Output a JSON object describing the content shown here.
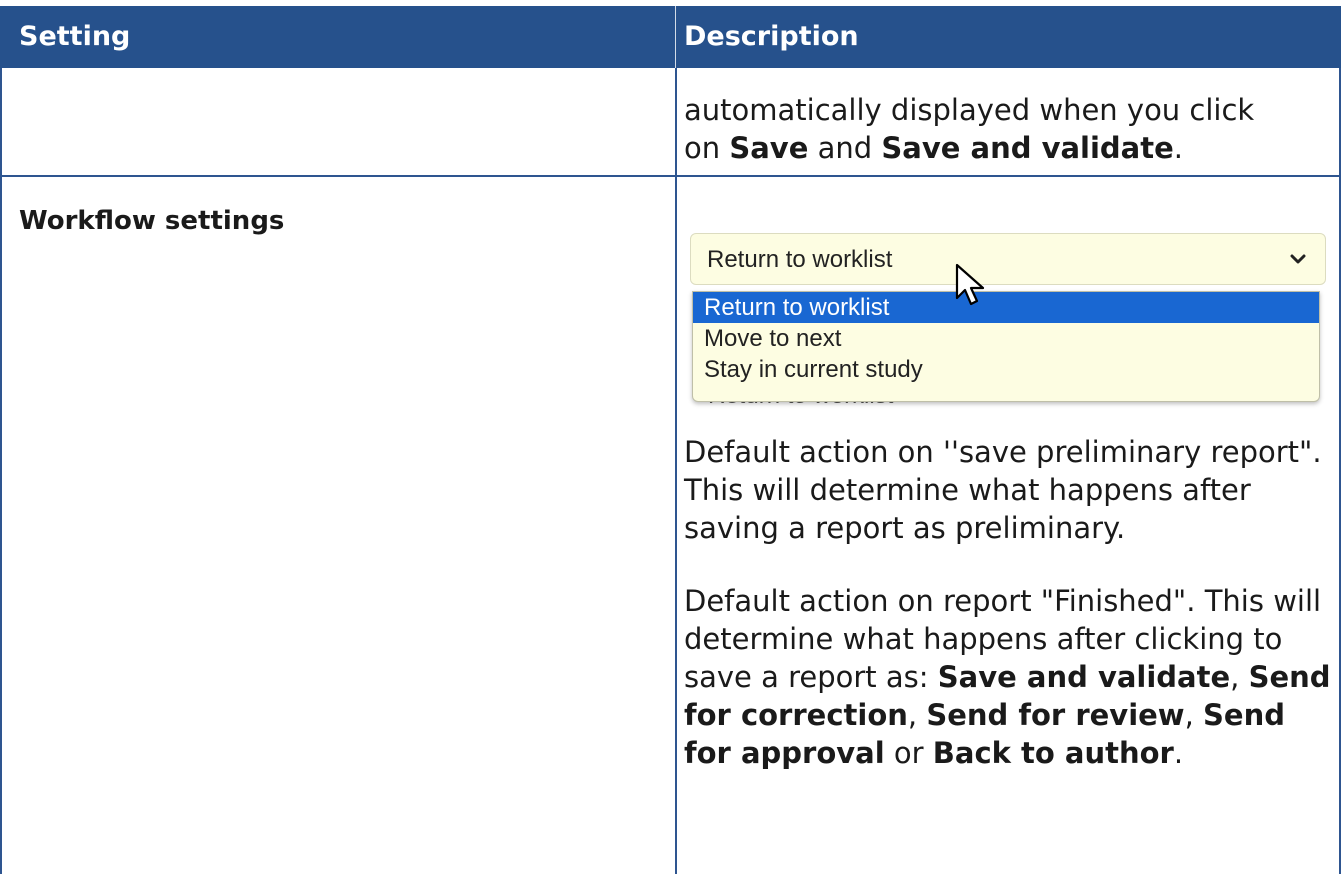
{
  "header": {
    "col_setting": "Setting",
    "col_description": "Description"
  },
  "row1": {
    "desc_part1": "automatically displayed when you click",
    "desc_on": "on ",
    "desc_save": "Save",
    "desc_and": " and ",
    "desc_save_validate": "Save and validate",
    "desc_period": "."
  },
  "row2": {
    "setting": "Workflow settings",
    "dropdown": {
      "value": "Return to worklist",
      "options": [
        "Return to worklist",
        "Move to next",
        "Stay in current study"
      ],
      "selected_index": 0,
      "partially_hidden_value": "Return to worklist"
    },
    "para1": "Default action on ''save preliminary report\". This will determine what happens after saving a report as preliminary.",
    "para2_text": "Default action on report \"Finished\". This will determine what happens after clicking to save a report as: ",
    "para2_b1": "Save and validate",
    "para2_sep1": ", ",
    "para2_b2": "Send for correction",
    "para2_sep2": ", ",
    "para2_b3": "Send for review",
    "para2_sep3": ", ",
    "para2_b4": "Send for approval",
    "para2_or": " or ",
    "para2_b5": "Back to author",
    "para2_end": "."
  },
  "colors": {
    "header_bg": "#26518c",
    "border": "#2e5590",
    "dropdown_bg": "#fdfde2",
    "option_selected": "#1967d2"
  }
}
